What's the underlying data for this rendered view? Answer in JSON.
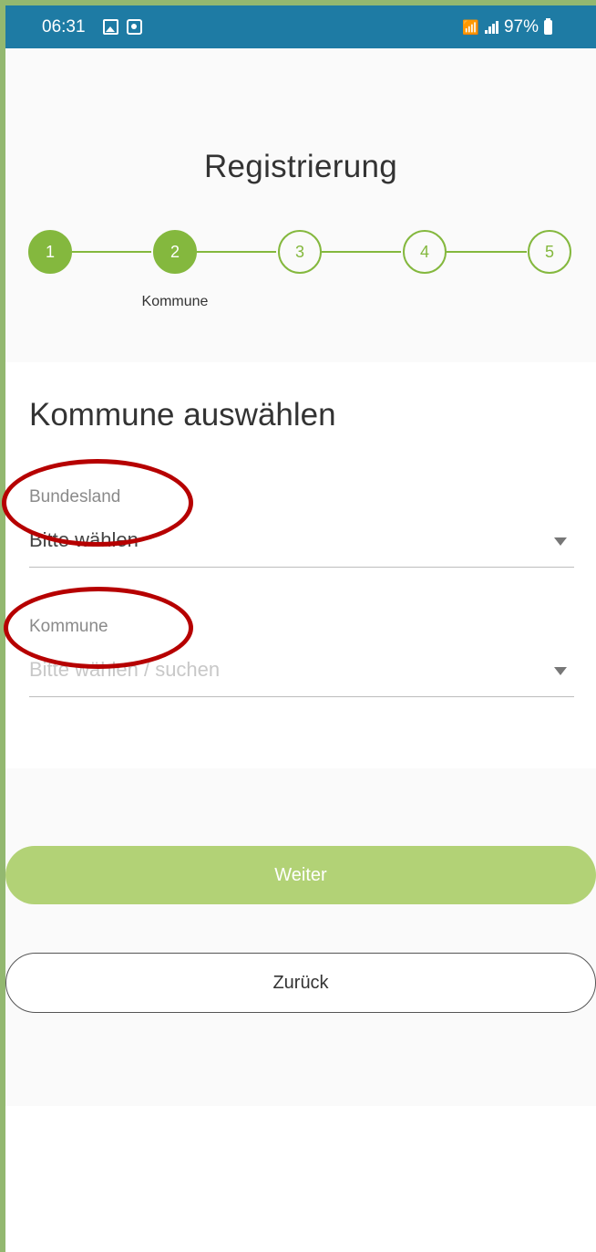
{
  "status_bar": {
    "time": "06:31",
    "left_icons": [
      "gallery-icon",
      "record-icon"
    ],
    "right_icons": [
      "wifi-icon",
      "signal-icon",
      "battery-icon"
    ],
    "battery": "97%",
    "background": "#1e7ba4"
  },
  "header": {
    "title": "Registrierung"
  },
  "stepper": {
    "steps": [
      {
        "number": "1",
        "state": "done"
      },
      {
        "number": "2",
        "state": "current",
        "label": "Kommune"
      },
      {
        "number": "3",
        "state": "pending"
      },
      {
        "number": "4",
        "state": "pending"
      },
      {
        "number": "5",
        "state": "pending"
      }
    ],
    "accent_color": "#84b83e"
  },
  "form": {
    "section_title": "Kommune auswählen",
    "fields": [
      {
        "label": "Bundesland",
        "value": "Bitte wählen",
        "is_placeholder": false
      },
      {
        "label": "Kommune",
        "value": "Bitte wählen / suchen",
        "is_placeholder": true
      }
    ]
  },
  "actions": {
    "next_label": "Weiter",
    "back_label": "Zurück",
    "next_color": "#b2d276"
  },
  "annotations": {
    "ring_color": "#b60000"
  }
}
